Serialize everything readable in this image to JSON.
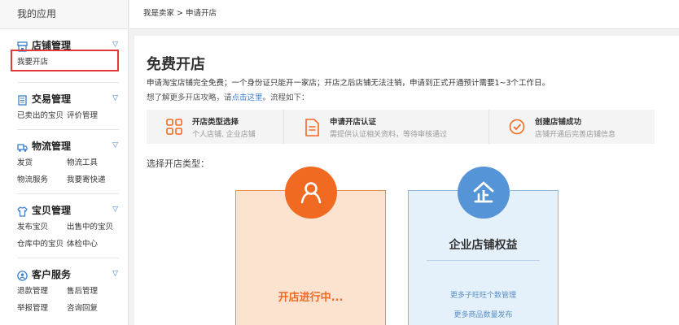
{
  "sidebar": {
    "title": "我的应用",
    "groups": [
      {
        "title": "店铺管理",
        "icon": "shop-icon",
        "items": [
          "我要开店"
        ]
      },
      {
        "title": "交易管理",
        "icon": "trade-icon",
        "items": [
          "已卖出的宝贝",
          "评价管理"
        ]
      },
      {
        "title": "物流管理",
        "icon": "truck-icon",
        "items": [
          "发货",
          "物流工具",
          "物流服务",
          "我要寄快递"
        ]
      },
      {
        "title": "宝贝管理",
        "icon": "shirt-icon",
        "items": [
          "发布宝贝",
          "出售中的宝贝",
          "仓库中的宝贝",
          "体检中心"
        ]
      },
      {
        "title": "客户服务",
        "icon": "user-service-icon",
        "items": [
          "退款管理",
          "售后管理",
          "举报管理",
          "咨询回复"
        ]
      }
    ]
  },
  "breadcrumb": "我是卖家 > 申请开店",
  "main": {
    "title": "免费开店",
    "desc1": "申请淘宝店铺完全免费；一个身份证只能开一家店；开店之后店铺无法注销，申请到正式开通预计需要1~3个工作日。",
    "desc2_prefix": "想了解更多开店攻略，请",
    "desc2_link": "点击这里",
    "desc2_suffix": "。流程如下：",
    "steps": [
      {
        "title": "开店类型选择",
        "sub": "个人店铺, 企业店铺"
      },
      {
        "title": "申请开店认证",
        "sub": "需提供认证相关资料，等待审核通过"
      },
      {
        "title": "创建店铺成功",
        "sub": "店铺开通后完善店铺信息"
      }
    ],
    "choose_label": "选择开店类型：",
    "personal_card": {
      "status": "开店进行中..."
    },
    "company_card": {
      "title": "企业店铺权益",
      "feature1": "更多子旺旺个数管理",
      "feature2": "更多商品数量发布"
    }
  },
  "colors": {
    "orange": "#f06a22",
    "blue": "#5594d6",
    "link": "#3a7bd5",
    "highlight": "#e03a3a"
  }
}
